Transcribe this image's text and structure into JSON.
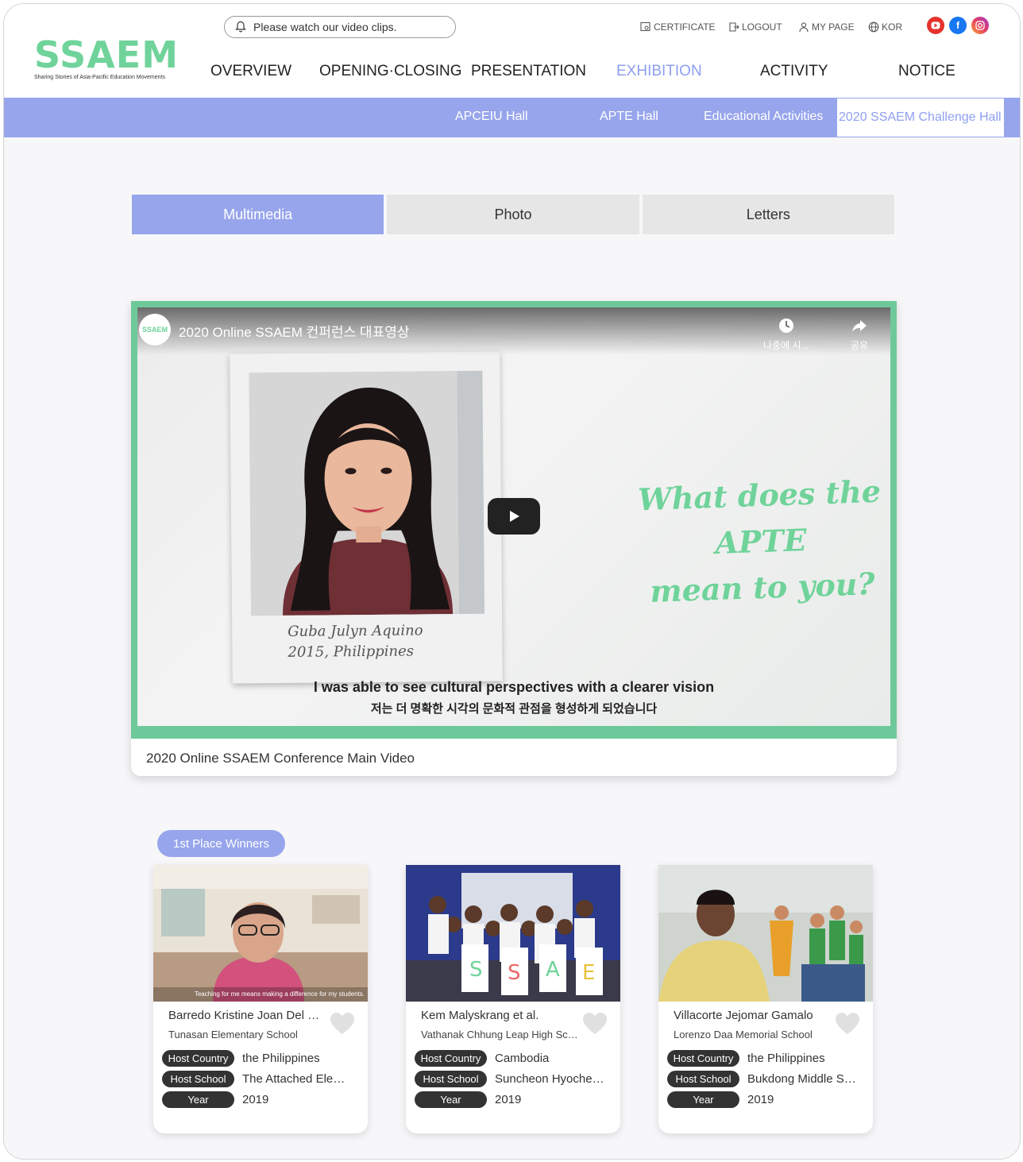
{
  "header": {
    "logo_text": "SSAEM",
    "logo_subtitle": "Sharing Stories of Asia-Pacific Education Movements",
    "notice_text": "Please watch our video clips.",
    "utility": {
      "certificate": "CERTIFICATE",
      "logout": "LOGOUT",
      "my_page": "MY PAGE",
      "language": "KOR"
    },
    "social": [
      "youtube-icon",
      "facebook-icon",
      "instagram-icon"
    ]
  },
  "main_nav": [
    "OVERVIEW",
    "OPENING·CLOSING",
    "PRESENTATION",
    "EXHIBITION",
    "ACTIVITY",
    "NOTICE"
  ],
  "sub_nav": [
    "APCEIU Hall",
    "APTE Hall",
    "Educational Activities",
    "2020 SSAEM Challenge Hall"
  ],
  "tabs": [
    "Multimedia",
    "Photo",
    "Letters"
  ],
  "video": {
    "title": "2020 Online SSAEM 컨퍼런스 대표영상",
    "watch_later": "나중에 시...",
    "share": "공유",
    "avatar_text": "SSAEM",
    "polaroid_line1": "Guba Julyn Aquino",
    "polaroid_line2": "2015, Philippines",
    "quote_line1": "What does the APTE",
    "quote_line2": "mean to you?",
    "subtitle_en": "I was able to see cultural perspectives with a clearer vision",
    "subtitle_ko": "저는 더 명확한 시각의 문화적 관점을 형성하게 되었습니다",
    "caption": "2020 Online SSAEM Conference Main Video"
  },
  "winners_badge": "1st Place Winners",
  "card_labels": {
    "host_country": "Host Country",
    "host_school": "Host School",
    "year": "Year"
  },
  "cards": [
    {
      "name": "Barredo Kristine Joan Del Rosario",
      "school": "Tunasan Elementary School",
      "host_country": "the Philippines",
      "host_school": "The Attached Elementary School",
      "year": "2019",
      "thumb_caption": "Teaching for me means making a difference for my students."
    },
    {
      "name": "Kem Malyskrang et al.",
      "school": "Vathanak Chhung Leap High School",
      "host_country": "Cambodia",
      "host_school": "Suncheon Hyocheon High School",
      "year": "2019",
      "thumb_caption": ""
    },
    {
      "name": "Villacorte Jejomar Gamalo",
      "school": "Lorenzo Daa Memorial School",
      "host_country": "the Philippines",
      "host_school": "Bukdong Middle School",
      "year": "2019",
      "thumb_caption": ""
    }
  ],
  "colors": {
    "accent_purple": "#97a5ec",
    "accent_green": "#6fd39a",
    "label_dark": "#333333"
  }
}
